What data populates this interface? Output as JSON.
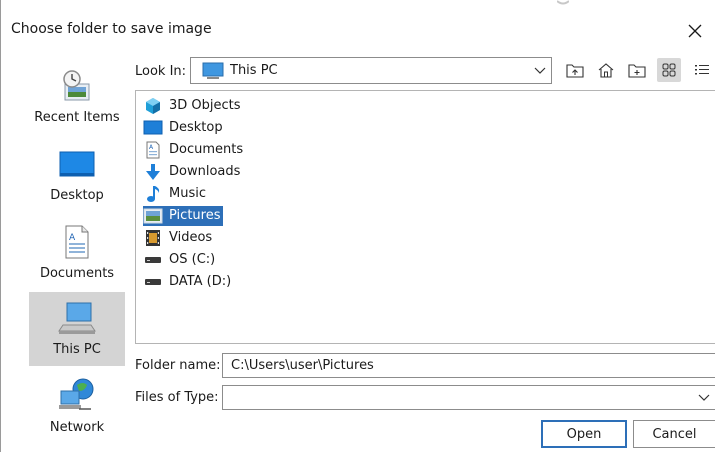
{
  "dialog": {
    "title": "Choose folder to save image"
  },
  "places": [
    {
      "label": "Recent Items",
      "icon": "recent-items-icon",
      "selected": false
    },
    {
      "label": "Desktop",
      "icon": "desktop-icon",
      "selected": false
    },
    {
      "label": "Documents",
      "icon": "documents-icon",
      "selected": false
    },
    {
      "label": "This PC",
      "icon": "this-pc-icon",
      "selected": true
    },
    {
      "label": "Network",
      "icon": "network-icon",
      "selected": false
    }
  ],
  "look_in": {
    "label": "Look In:",
    "value": "This PC"
  },
  "files": [
    {
      "name": "3D Objects",
      "icon": "3d-objects-icon",
      "selected": false
    },
    {
      "name": "Desktop",
      "icon": "desktop-folder-icon",
      "selected": false
    },
    {
      "name": "Documents",
      "icon": "documents-folder-icon",
      "selected": false
    },
    {
      "name": "Downloads",
      "icon": "downloads-icon",
      "selected": false
    },
    {
      "name": "Music",
      "icon": "music-icon",
      "selected": false
    },
    {
      "name": "Pictures",
      "icon": "pictures-icon",
      "selected": true
    },
    {
      "name": "Videos",
      "icon": "videos-icon",
      "selected": false
    },
    {
      "name": "OS (C:)",
      "icon": "drive-icon",
      "selected": false
    },
    {
      "name": "DATA (D:)",
      "icon": "drive-icon",
      "selected": false
    }
  ],
  "folder_name": {
    "label": "Folder name:",
    "value": "C:\\Users\\user\\Pictures"
  },
  "files_of_type": {
    "label": "Files of Type:",
    "value": ""
  },
  "buttons": {
    "open": "Open",
    "cancel": "Cancel"
  },
  "colors": {
    "selection": "#2d6fb8",
    "places_selected": "#d4d4d4"
  }
}
